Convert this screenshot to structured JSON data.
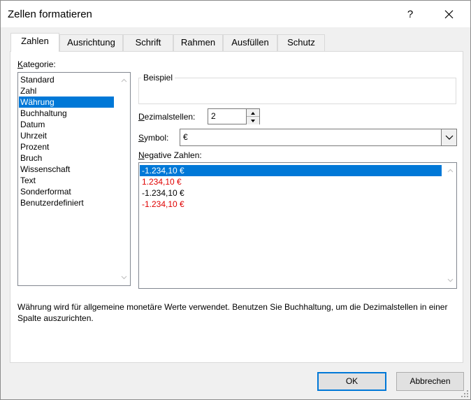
{
  "window": {
    "title": "Zellen formatieren",
    "help_glyph": "?",
    "close_icon": "close-icon"
  },
  "tabs": [
    {
      "label": "Zahlen",
      "active": true
    },
    {
      "label": "Ausrichtung",
      "active": false
    },
    {
      "label": "Schrift",
      "active": false
    },
    {
      "label": "Rahmen",
      "active": false
    },
    {
      "label": "Ausfüllen",
      "active": false
    },
    {
      "label": "Schutz",
      "active": false
    }
  ],
  "category": {
    "label_first": "K",
    "label_rest": "ategorie:",
    "items": [
      "Standard",
      "Zahl",
      "Währung",
      "Buchhaltung",
      "Datum",
      "Uhrzeit",
      "Prozent",
      "Bruch",
      "Wissenschaft",
      "Text",
      "Sonderformat",
      "Benutzerdefiniert"
    ],
    "selected": "Währung"
  },
  "sample": {
    "legend": "Beispiel",
    "value": ""
  },
  "decimals": {
    "label_first": "D",
    "label_rest": "ezimalstellen:",
    "value": "2"
  },
  "symbol": {
    "label_first": "S",
    "label_rest": "ymbol:",
    "value": "€"
  },
  "negative": {
    "label_first": "N",
    "label_rest": "egative Zahlen:",
    "items": [
      {
        "text": "-1.234,10 €",
        "selected": true,
        "color": "#000000"
      },
      {
        "text": "1.234,10 €",
        "selected": false,
        "color": "#e00000"
      },
      {
        "text": "-1.234,10 €",
        "selected": false,
        "color": "#000000"
      },
      {
        "text": "-1.234,10 €",
        "selected": false,
        "color": "#e00000"
      }
    ]
  },
  "description": "Währung wird für allgemeine monetäre Werte verwendet. Benutzen Sie Buchhaltung, um die Dezimalstellen in einer Spalte auszurichten.",
  "buttons": {
    "ok": "OK",
    "cancel": "Abbrechen"
  },
  "colors": {
    "accent": "#0078d7",
    "negative_red": "#e00000",
    "dialog_bg": "#f0f0f0"
  }
}
